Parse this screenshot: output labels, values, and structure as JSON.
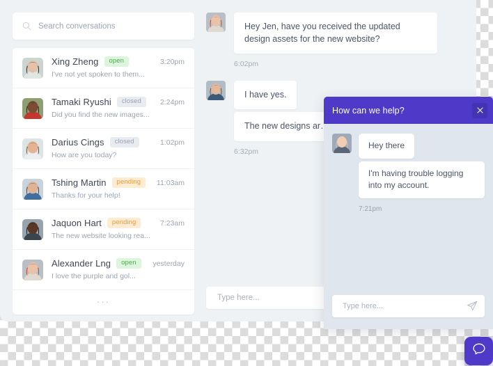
{
  "search": {
    "placeholder": "Search conversations",
    "value": "",
    "icon": "search-icon"
  },
  "conversations": {
    "more_label": "···",
    "items": [
      {
        "name": "Xing Zheng",
        "status": "open",
        "time": "3:20pm",
        "snippet": "I've not yet spoken to them...",
        "avatar_class": "av-xing"
      },
      {
        "name": "Tamaki Ryushi",
        "status": "closed",
        "time": "2:24pm",
        "snippet": "Did you find the new images...",
        "avatar_class": "av-tamaki"
      },
      {
        "name": "Darius Cings",
        "status": "closed",
        "time": "1:02pm",
        "snippet": "How are you today?",
        "avatar_class": "av-darius"
      },
      {
        "name": "Tshing Martin",
        "status": "pending",
        "time": "11:03am",
        "snippet": "Thanks for your help!",
        "avatar_class": "av-tshing"
      },
      {
        "name": "Jaquon Hart",
        "status": "pending",
        "time": "7:23am",
        "snippet": "The new website looking rea...",
        "avatar_class": "av-jaquon"
      },
      {
        "name": "Alexander Lng",
        "status": "open",
        "time": "yesterday",
        "snippet": "I love the purple and gol...",
        "avatar_class": "av-alexander"
      }
    ]
  },
  "thread": {
    "groups": [
      {
        "avatar": "av-alexander",
        "bubbles": [
          "Hey Jen, have you received the updated design assets for the new website?"
        ],
        "time": "6:02pm"
      },
      {
        "avatar": "av-jen",
        "bubbles": [
          "I have yes.",
          "The new designs ar…\nWell done Jen :)"
        ],
        "time": "6:32pm"
      }
    ],
    "composer": {
      "placeholder": "Type here...",
      "value": ""
    }
  },
  "widget": {
    "title": "How can we help?",
    "close_icon": "close-icon",
    "groups": [
      {
        "avatar": "av-agent",
        "bubbles": [
          "Hey there",
          "I'm having trouble logging into my account."
        ],
        "time": "7:21pm"
      }
    ],
    "composer": {
      "placeholder": "Type here...",
      "value": "",
      "send_icon": "send-paper-plane-icon"
    }
  },
  "launcher": {
    "icon": "chat-bubble-icon",
    "label": "Open chat"
  },
  "colors": {
    "brand_purple": "#4f39c9",
    "brand_purple_dark": "#4433b5",
    "canvas": "#eef2f5",
    "widget_body": "#dfe6ee",
    "badge_open_bg": "#ddf5dd",
    "badge_open_fg": "#4cad4c",
    "badge_closed_bg": "#e8ecf1",
    "badge_closed_fg": "#97a1b0",
    "badge_pending_bg": "#fdecd2",
    "badge_pending_fg": "#eb9a3c"
  }
}
